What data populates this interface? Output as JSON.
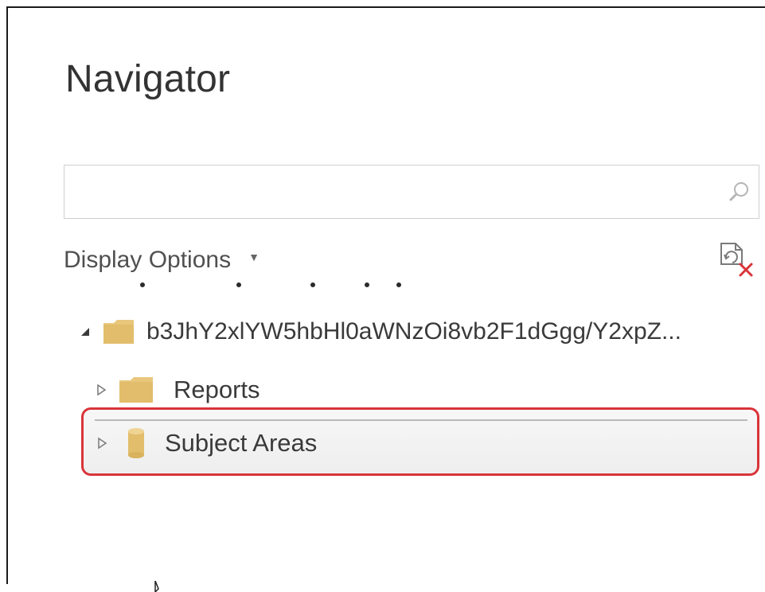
{
  "navigator": {
    "title": "Navigator",
    "search": {
      "placeholder": "",
      "value": ""
    },
    "display_options_label": "Display Options",
    "tree": [
      {
        "label": "b3JhY2xlYW5hbHl0aWNzOi8vb2F1dGgg/Y2xpZ...",
        "expanded": true,
        "icon": "folder-icon"
      },
      {
        "label": "Reports",
        "expanded": false,
        "icon": "folder-icon"
      },
      {
        "label": "Subject Areas",
        "expanded": false,
        "icon": "cylinder-icon",
        "highlighted": true
      }
    ]
  },
  "colors": {
    "highlight_border": "#d9343a",
    "folder": "#e8c77c",
    "text": "#333333"
  }
}
